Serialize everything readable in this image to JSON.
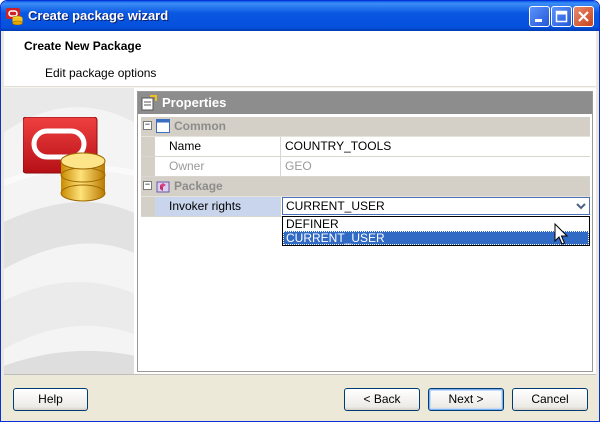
{
  "window": {
    "title": "Create package wizard"
  },
  "header": {
    "title": "Create New Package",
    "subtitle": "Edit package options"
  },
  "properties": {
    "title": "Properties",
    "categories": [
      {
        "label": "Common",
        "expanded": true,
        "rows": [
          {
            "name": "Name",
            "value": "COUNTRY_TOOLS",
            "enabled": true
          },
          {
            "name": "Owner",
            "value": "GEO",
            "enabled": false
          }
        ]
      },
      {
        "label": "Package",
        "expanded": true,
        "rows": [
          {
            "name": "Invoker rights",
            "value": "CURRENT_USER",
            "enabled": true
          }
        ]
      }
    ],
    "dropdown_options": [
      "DEFINER",
      "CURRENT_USER"
    ],
    "dropdown_selected": "CURRENT_USER"
  },
  "footer": {
    "help_label": "Help",
    "back_label": "< Back",
    "next_label": "Next >",
    "cancel_label": "Cancel"
  },
  "icons": {
    "app": "oracle-package-icon",
    "wizard_image": "oracle-database-icon",
    "properties": "properties-icon",
    "common_category": "category-box-icon",
    "package_category": "package-icon",
    "cursor": "mouse-pointer-icon"
  },
  "colors": {
    "titlebar": "#0a58e2",
    "selection": "#316ac5",
    "oracle_red": "#d01f25",
    "panel_header": "#8d8d8d"
  }
}
